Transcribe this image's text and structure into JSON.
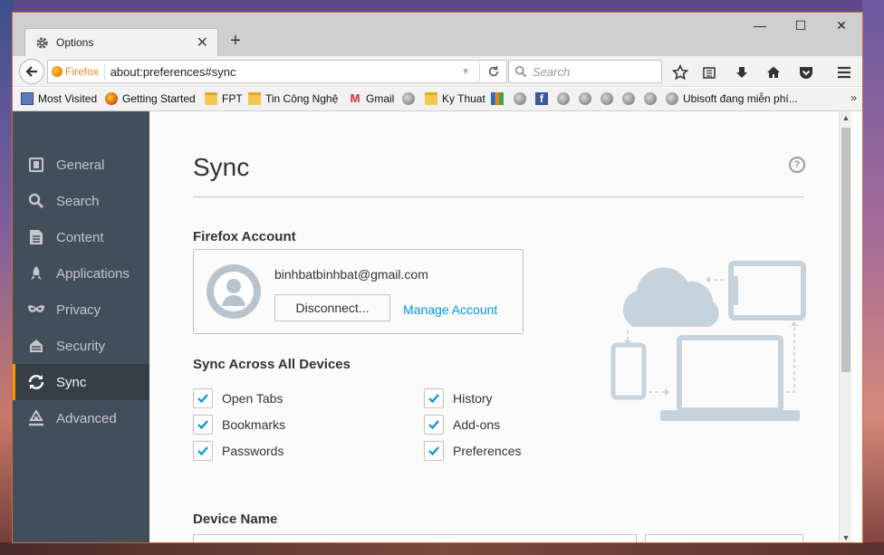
{
  "window": {
    "tab_title": "Options",
    "new_tab_symbol": "+",
    "controls": {
      "minimize": "—",
      "maximize": "☐",
      "close": "✕"
    }
  },
  "navbar": {
    "identity_label": "Firefox",
    "url": "about:preferences#sync",
    "search_placeholder": "Search"
  },
  "bookmarks": [
    {
      "label": "Most Visited",
      "icon": "most-visited-icon"
    },
    {
      "label": "Getting Started",
      "icon": "firefox-icon"
    },
    {
      "label": "FPT",
      "icon": "folder-icon"
    },
    {
      "label": "Tin Công Nghệ",
      "icon": "folder-icon"
    },
    {
      "label": "Gmail",
      "icon": "gmail-icon"
    },
    {
      "label": "",
      "icon": "globe-icon"
    },
    {
      "label": "Ky Thuat",
      "icon": "folder-icon"
    },
    {
      "label": "",
      "icon": "fpt-icon"
    },
    {
      "label": "",
      "icon": "globe-icon"
    },
    {
      "label": "",
      "icon": "facebook-icon"
    },
    {
      "label": "",
      "icon": "globe-icon"
    },
    {
      "label": "",
      "icon": "globe-icon"
    },
    {
      "label": "",
      "icon": "globe-icon"
    },
    {
      "label": "",
      "icon": "globe-icon"
    },
    {
      "label": "",
      "icon": "globe-icon"
    },
    {
      "label": "Ubisoft đang miễn phí...",
      "icon": "globe-icon"
    }
  ],
  "bookmarks_overflow": "»",
  "sidebar": {
    "items": [
      {
        "label": "General",
        "icon": "general-icon",
        "active": false
      },
      {
        "label": "Search",
        "icon": "search-icon",
        "active": false
      },
      {
        "label": "Content",
        "icon": "content-icon",
        "active": false
      },
      {
        "label": "Applications",
        "icon": "applications-icon",
        "active": false
      },
      {
        "label": "Privacy",
        "icon": "privacy-mask-icon",
        "active": false
      },
      {
        "label": "Security",
        "icon": "security-icon",
        "active": false
      },
      {
        "label": "Sync",
        "icon": "sync-icon",
        "active": true
      },
      {
        "label": "Advanced",
        "icon": "advanced-icon",
        "active": false
      }
    ],
    "accent_color": "#ff9500"
  },
  "main": {
    "title": "Sync",
    "help_symbol": "?",
    "account_heading": "Firefox Account",
    "account_email": "binhbatbinhbat@gmail.com",
    "disconnect_label": "Disconnect...",
    "manage_label": "Manage Account",
    "sync_heading": "Sync Across All Devices",
    "sync_options": [
      {
        "label": "Open Tabs",
        "checked": true
      },
      {
        "label": "History",
        "checked": true
      },
      {
        "label": "Bookmarks",
        "checked": true
      },
      {
        "label": "Add-ons",
        "checked": true
      },
      {
        "label": "Passwords",
        "checked": true
      },
      {
        "label": "Preferences",
        "checked": true
      }
    ],
    "device_heading": "Device Name",
    "link_color": "#0096dd"
  }
}
